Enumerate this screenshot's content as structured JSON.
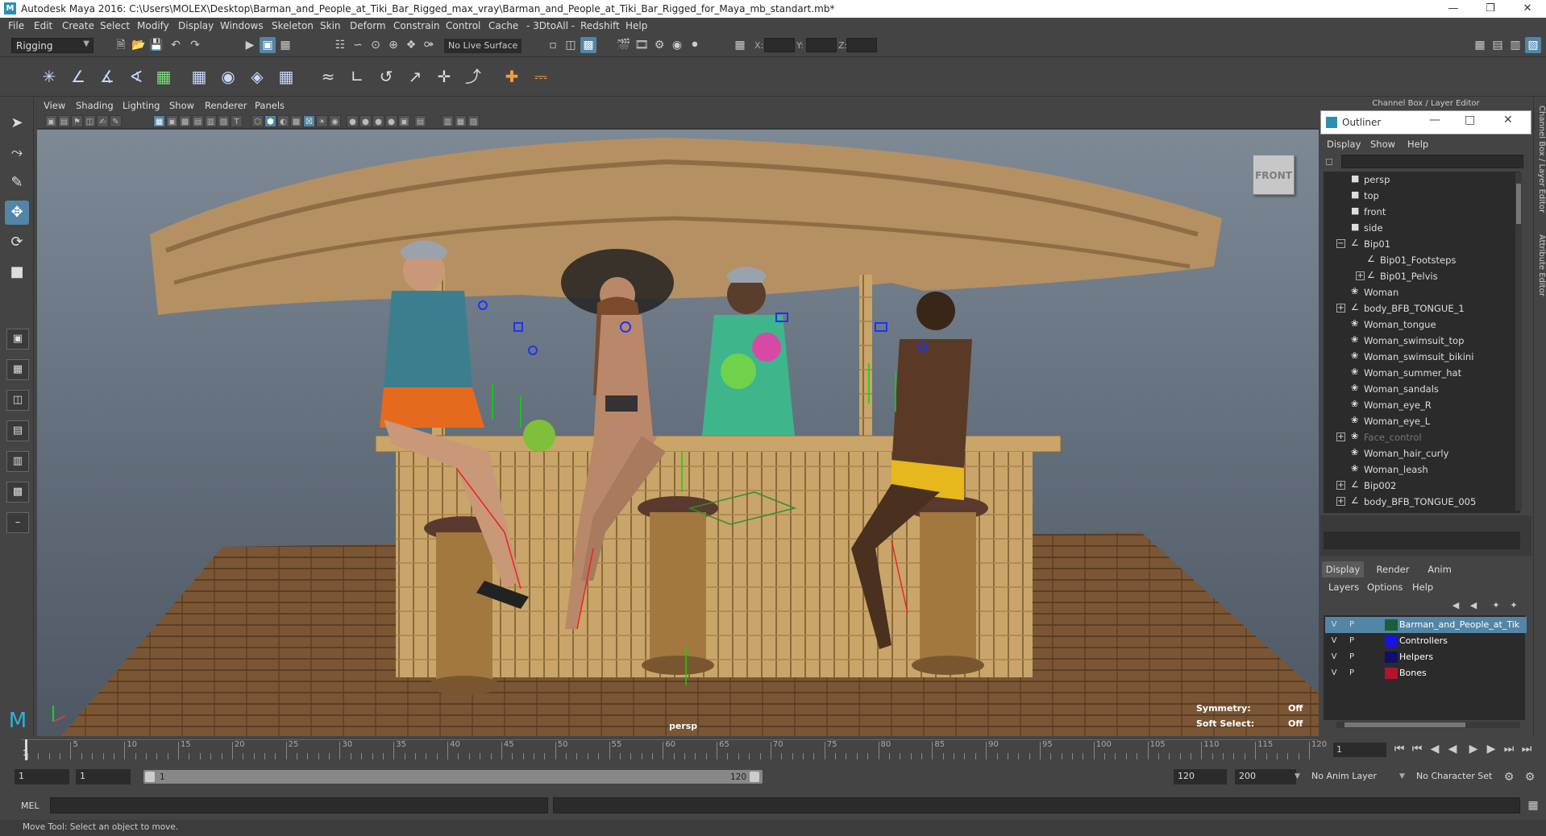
{
  "window": {
    "title": "Autodesk Maya 2016: C:\\Users\\MOLEX\\Desktop\\Barman_and_People_at_Tiki_Bar_Rigged_max_vray\\Barman_and_People_at_Tiki_Bar_Rigged_for_Maya_mb_standart.mb*"
  },
  "menu": [
    "File",
    "Edit",
    "Create",
    "Select",
    "Modify",
    "Display",
    "Windows",
    "Skeleton",
    "Skin",
    "Deform",
    "Constrain",
    "Control",
    "Cache",
    "- 3DtoAll -",
    "Redshift",
    "Help"
  ],
  "status": {
    "mode": "Rigging",
    "live_surface": "No Live Surface",
    "x_label": "X:",
    "y_label": "Y:",
    "z_label": "Z:"
  },
  "panel_menu": [
    "View",
    "Shading",
    "Lighting",
    "Show",
    "Renderer",
    "Panels"
  ],
  "viewport": {
    "camera": "persp",
    "view_cube": "FRONT",
    "symmetry_label": "Symmetry:",
    "symmetry_value": "Off",
    "soft_select_label": "Soft Select:",
    "soft_select_value": "Off"
  },
  "right_panel": {
    "title": "Channel Box / Layer Editor",
    "vtab1": "Channel Box / Layer Editor",
    "vtab2": "Attribute Editor"
  },
  "outliner": {
    "title": "Outliner",
    "menu": [
      "Display",
      "Show",
      "Help"
    ],
    "items": [
      {
        "label": "persp",
        "level": 2,
        "exp": ""
      },
      {
        "label": "top",
        "level": 2,
        "exp": ""
      },
      {
        "label": "front",
        "level": 2,
        "exp": ""
      },
      {
        "label": "side",
        "level": 2,
        "exp": ""
      },
      {
        "label": "Bip01",
        "level": 2,
        "exp": "-"
      },
      {
        "label": "Bip01_Footsteps",
        "level": 3,
        "exp": ""
      },
      {
        "label": "Bip01_Pelvis",
        "level": 3,
        "exp": "+"
      },
      {
        "label": "Woman",
        "level": 2,
        "exp": ""
      },
      {
        "label": "body_BFB_TONGUE_1",
        "level": 2,
        "exp": "+"
      },
      {
        "label": "Woman_tongue",
        "level": 2,
        "exp": ""
      },
      {
        "label": "Woman_swimsuit_top",
        "level": 2,
        "exp": ""
      },
      {
        "label": "Woman_swimsuit_bikini",
        "level": 2,
        "exp": ""
      },
      {
        "label": "Woman_summer_hat",
        "level": 2,
        "exp": ""
      },
      {
        "label": "Woman_sandals",
        "level": 2,
        "exp": ""
      },
      {
        "label": "Woman_eye_R",
        "level": 2,
        "exp": ""
      },
      {
        "label": "Woman_eye_L",
        "level": 2,
        "exp": ""
      },
      {
        "label": "Face_control",
        "level": 2,
        "exp": "+",
        "dim": true
      },
      {
        "label": "Woman_hair_curly",
        "level": 2,
        "exp": ""
      },
      {
        "label": "Woman_leash",
        "level": 2,
        "exp": ""
      },
      {
        "label": "Bip002",
        "level": 2,
        "exp": "+"
      },
      {
        "label": "body_BFB_TONGUE_005",
        "level": 2,
        "exp": "+"
      }
    ]
  },
  "layer_editor": {
    "tabs": [
      "Display",
      "Render",
      "Anim"
    ],
    "menu": [
      "Layers",
      "Options",
      "Help"
    ],
    "layers": [
      {
        "v": "V",
        "p": "P",
        "color": "#1b5e3a",
        "name": "Barman_and_People_at_Tiki_Bar_Rigged",
        "selected": true
      },
      {
        "v": "V",
        "p": "P",
        "color": "#1414e6",
        "name": "Controllers",
        "selected": false
      },
      {
        "v": "V",
        "p": "P",
        "color": "#101068",
        "name": "Helpers",
        "selected": false
      },
      {
        "v": "V",
        "p": "P",
        "color": "#b3142d",
        "name": "Bones",
        "selected": false
      }
    ]
  },
  "timeline": {
    "ticks": [
      "5",
      "10",
      "15",
      "20",
      "25",
      "30",
      "35",
      "40",
      "45",
      "50",
      "55",
      "60",
      "65",
      "70",
      "75",
      "80",
      "85",
      "90",
      "95",
      "100",
      "105",
      "110",
      "115",
      "120"
    ],
    "start_label": "1",
    "current_frame": "1"
  },
  "range": {
    "start": "1",
    "playback_start": "1",
    "slider_start": "1",
    "slider_end": "120",
    "playback_end": "120",
    "end": "200",
    "anim_layer": "No Anim Layer",
    "char_set": "No Character Set"
  },
  "command": {
    "label": "MEL"
  },
  "help_line": "Move Tool: Select an object to move."
}
